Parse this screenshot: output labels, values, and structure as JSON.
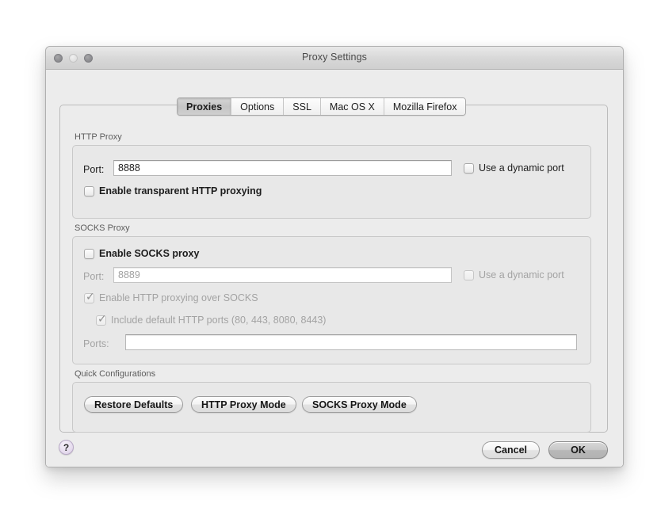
{
  "window": {
    "title": "Proxy Settings",
    "traffic_lights": [
      "close-button",
      "minimize-button",
      "zoom-button"
    ]
  },
  "tabs": [
    {
      "label": "Proxies",
      "selected": true
    },
    {
      "label": "Options",
      "selected": false
    },
    {
      "label": "SSL",
      "selected": false
    },
    {
      "label": "Mac OS X",
      "selected": false
    },
    {
      "label": "Mozilla Firefox",
      "selected": false
    }
  ],
  "http_proxy": {
    "group_label": "HTTP Proxy",
    "port_label": "Port:",
    "port_value": "8888",
    "dynamic_port_label": "Use a dynamic port",
    "dynamic_port_checked": false,
    "transparent_label": "Enable transparent HTTP proxying",
    "transparent_checked": false
  },
  "socks_proxy": {
    "group_label": "SOCKS Proxy",
    "enable_label": "Enable SOCKS proxy",
    "enable_checked": false,
    "port_label": "Port:",
    "port_value": "8889",
    "dynamic_port_label": "Use a dynamic port",
    "dynamic_port_checked": false,
    "http_over_socks_label": "Enable HTTP proxying over SOCKS",
    "http_over_socks_checked": true,
    "include_default_label": "Include default HTTP ports (80, 443, 8080, 8443)",
    "include_default_checked": true,
    "ports_label": "Ports:",
    "ports_value": ""
  },
  "quick_configurations": {
    "group_label": "Quick Configurations",
    "buttons": [
      {
        "label": "Restore Defaults"
      },
      {
        "label": "HTTP Proxy Mode"
      },
      {
        "label": "SOCKS Proxy Mode"
      }
    ]
  },
  "footer": {
    "help_label": "?",
    "cancel_label": "Cancel",
    "ok_label": "OK"
  },
  "colors": {
    "window_bg": "#ececec",
    "group_bg": "#e8e8e8",
    "disabled_text": "#a3a3a3",
    "enabled_text": "#1d1d1d",
    "help_accent": "#d9cce4"
  }
}
